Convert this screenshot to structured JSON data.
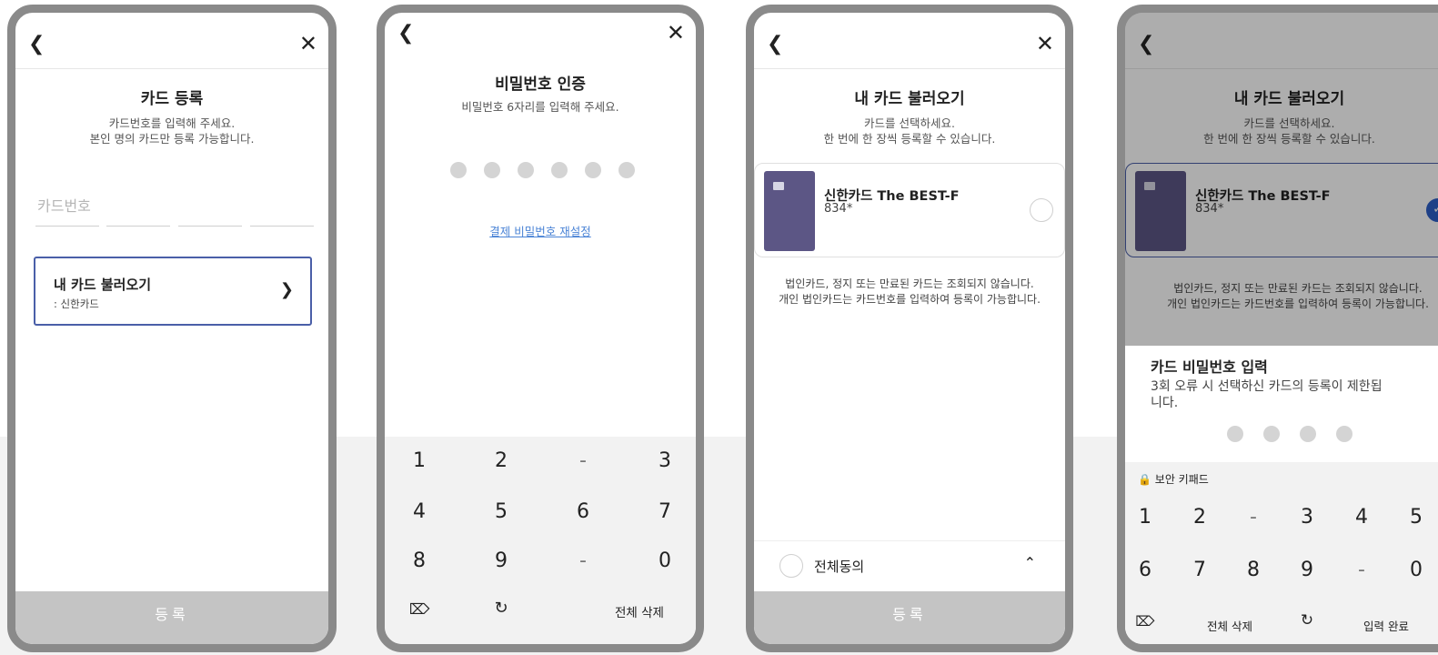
{
  "screen1": {
    "title": "카드 등록",
    "subtitle_line1": "카드번호를 입력해 주세요.",
    "subtitle_line2": "본인 명의 카드만 등록 가능합니다.",
    "card_number_placeholder": "카드번호",
    "load_card": {
      "title": "내 카드 불러오기",
      "subtitle": ": 신한카드"
    },
    "register_button": "등록"
  },
  "screen2": {
    "title": "비밀번호 인증",
    "subtitle": "비밀번호 6자리를 입력해 주세요.",
    "pin_dot_count": 6,
    "reset_link": "결제 비밀번호 재설정",
    "keypad": {
      "row1": [
        "1",
        "2",
        "-",
        "3"
      ],
      "row2": [
        "4",
        "5",
        "6",
        "7"
      ],
      "row3": [
        "8",
        "9",
        "-",
        "0"
      ],
      "clear_all": "전체 삭제"
    }
  },
  "screen3": {
    "title": "내 카드 불러오기",
    "subtitle_line1": "카드를 선택하세요.",
    "subtitle_line2": "한 번에 한 장씩 등록할 수 있습니다.",
    "card": {
      "name": "신한카드 The BEST-F",
      "number": "834*"
    },
    "notice_line1": "법인카드, 정지 또는 만료된 카드는 조회되지 않습니다.",
    "notice_line2": "개인 법인카드는 카드번호를 입력하여 등록이 가능합니다.",
    "agree_all": "전체동의",
    "register_button": "등록"
  },
  "screen4": {
    "title": "내 카드 불러오기",
    "subtitle_line1": "카드를 선택하세요.",
    "subtitle_line2": "한 번에 한 장씩 등록할 수 있습니다.",
    "card": {
      "name": "신한카드 The BEST-F",
      "number": "834*"
    },
    "notice_line1": "법인카드, 정지 또는 만료된 카드는 조회되지 않습니다.",
    "notice_line2": "개인 법인카드는 카드번호를 입력하여 등록이 가능합니다.",
    "sheet_title": "카드 비밀번호 입력",
    "sheet_desc": "3회 오류 시 선택하신 카드의 등록이 제한됩니다.",
    "pin_dot_count": 4,
    "secure_keypad_label": "보안 키패드",
    "keypad": {
      "row1": [
        "1",
        "2",
        "-",
        "3",
        "4",
        "5"
      ],
      "row2": [
        "6",
        "7",
        "8",
        "9",
        "-",
        "0"
      ],
      "clear_all": "전체 삭제",
      "done": "입력 완료"
    }
  },
  "colors": {
    "accent_border": "#4a5fa8",
    "check_blue": "#2d5fc8",
    "link_blue": "#4b84d6",
    "card_purple": "#5c5685"
  }
}
